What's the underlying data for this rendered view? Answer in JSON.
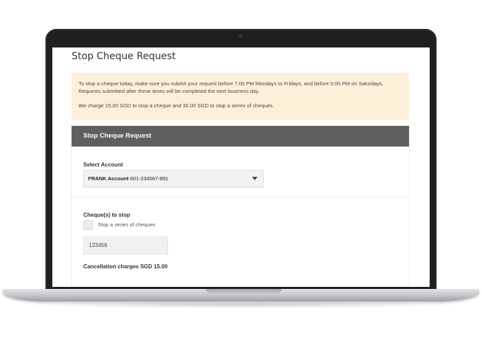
{
  "page": {
    "title": "Stop Cheque Request"
  },
  "notice": {
    "line1": "To stop a cheque today, make sure you submit your request before 7:00 PM Mondays to Fridays, and before 5:00 PM on Saturdays. Requests submitted after these times will be completed the next business day.",
    "line2": "We charge 15.00 SGD to stop a cheque and 30.00 SGD to stop a series of cheques."
  },
  "form": {
    "header": "Stop Cheque Request",
    "select_account_label": "Select Account",
    "account_name": "FRANK Account",
    "account_number": "601-234567-891",
    "cheques_label": "Cheque(s) to stop",
    "series_checkbox_label": "Stop a series of cheques",
    "series_checked": false,
    "cheque_number_value": "123456",
    "cancellation_charges": "Cancellation charges SGD 15.00"
  },
  "colors": {
    "notice_bg": "#fdf0d9",
    "header_bg": "#5f5f5f",
    "laptop_frame": "#1e1f21"
  }
}
